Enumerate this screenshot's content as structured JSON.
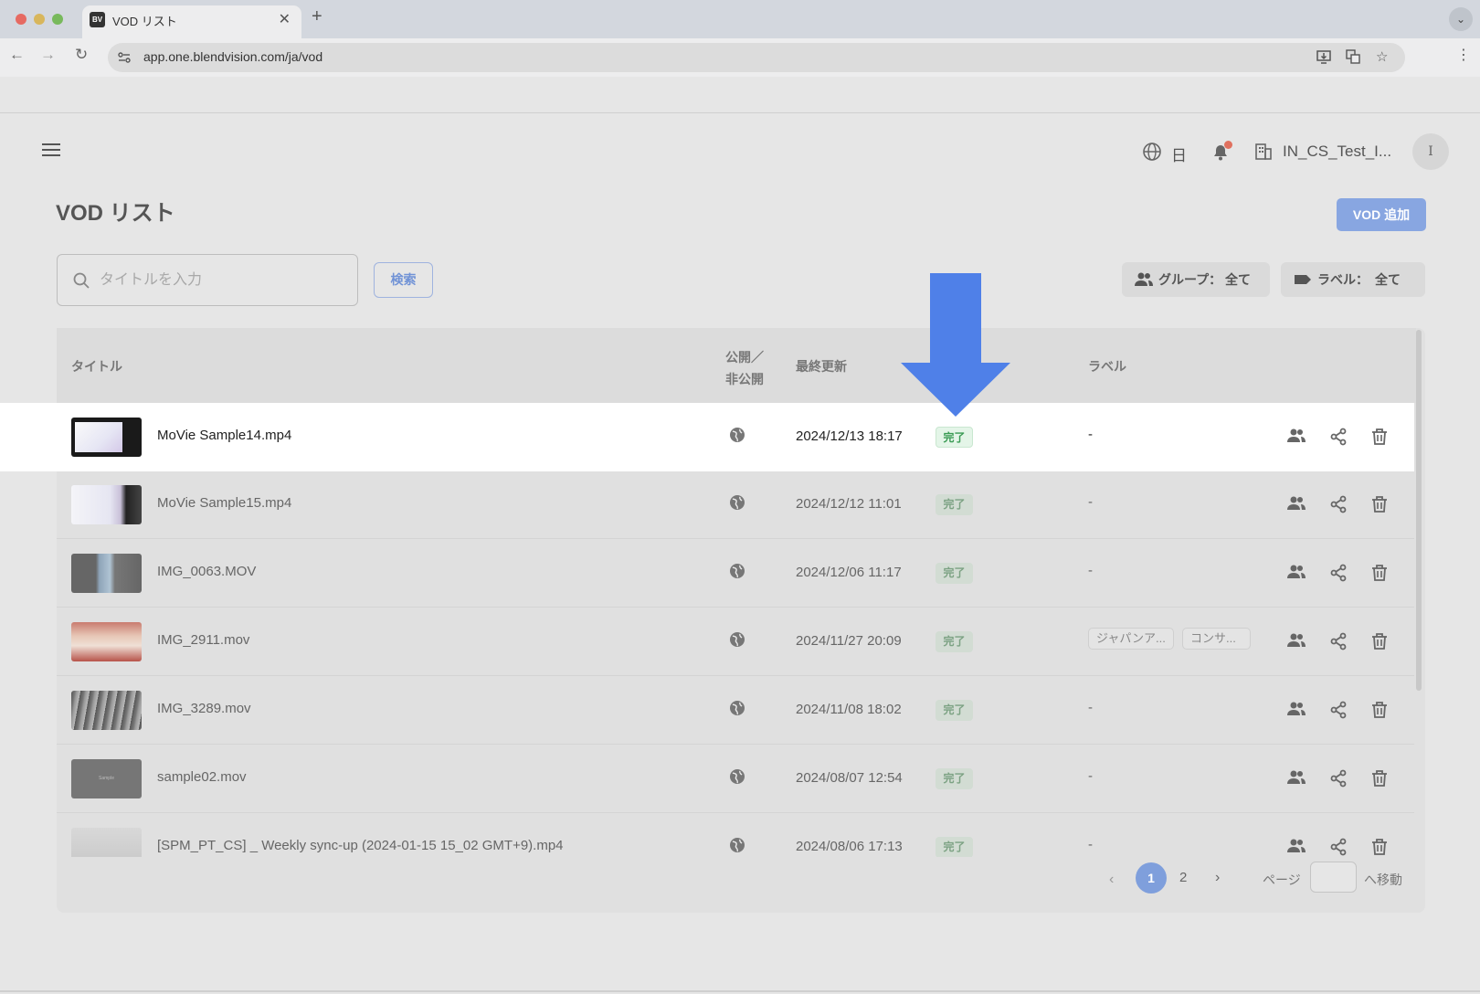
{
  "browser": {
    "tab_title": "VOD リスト",
    "tab_favicon_text": "BV",
    "url": "app.one.blendvision.com/ja/vod"
  },
  "header": {
    "language": "日",
    "org_name": "IN_CS_Test_I...",
    "avatar_initial": "I"
  },
  "page": {
    "title": "VOD リスト",
    "add_button": "VOD 追加",
    "search_placeholder": "タイトルを入力",
    "search_button": "検索",
    "filter_group": "グループ： 全て",
    "filter_label": "ラベル：　全て"
  },
  "table": {
    "columns": {
      "title": "タイトル",
      "public_line1": "公開／",
      "public_line2": "非公開",
      "updated": "最終更新",
      "label": "ラベル"
    },
    "rows": [
      {
        "title": "MoVie Sample14.mp4",
        "updated": "2024/12/13 18:17",
        "status": "完了",
        "label": "-"
      },
      {
        "title": "MoVie Sample15.mp4",
        "updated": "2024/12/12 11:01",
        "status": "完了",
        "label": "-"
      },
      {
        "title": "IMG_0063.MOV",
        "updated": "2024/12/06 11:17",
        "status": "完了",
        "label": "-"
      },
      {
        "title": "IMG_2911.mov",
        "updated": "2024/11/27 20:09",
        "status": "完了",
        "label": "",
        "tags": [
          "ジャパンア...",
          "コンサ..."
        ]
      },
      {
        "title": "IMG_3289.mov",
        "updated": "2024/11/08 18:02",
        "status": "完了",
        "label": "-"
      },
      {
        "title": "sample02.mov",
        "updated": "2024/08/07 12:54",
        "status": "完了",
        "label": "-",
        "thumb_text": "Sample"
      },
      {
        "title": "[SPM_PT_CS] _ Weekly sync-up (2024-01-15 15_02 GMT+9).mp4",
        "updated": "2024/08/06 17:13",
        "status": "完了",
        "label": "-"
      }
    ]
  },
  "pagination": {
    "pages": [
      "1",
      "2"
    ],
    "current": "1",
    "jump_label": "ページ",
    "jump_go": "へ移動"
  },
  "colors": {
    "accent": "#4f80e8",
    "status_green": "#3a9b54"
  }
}
